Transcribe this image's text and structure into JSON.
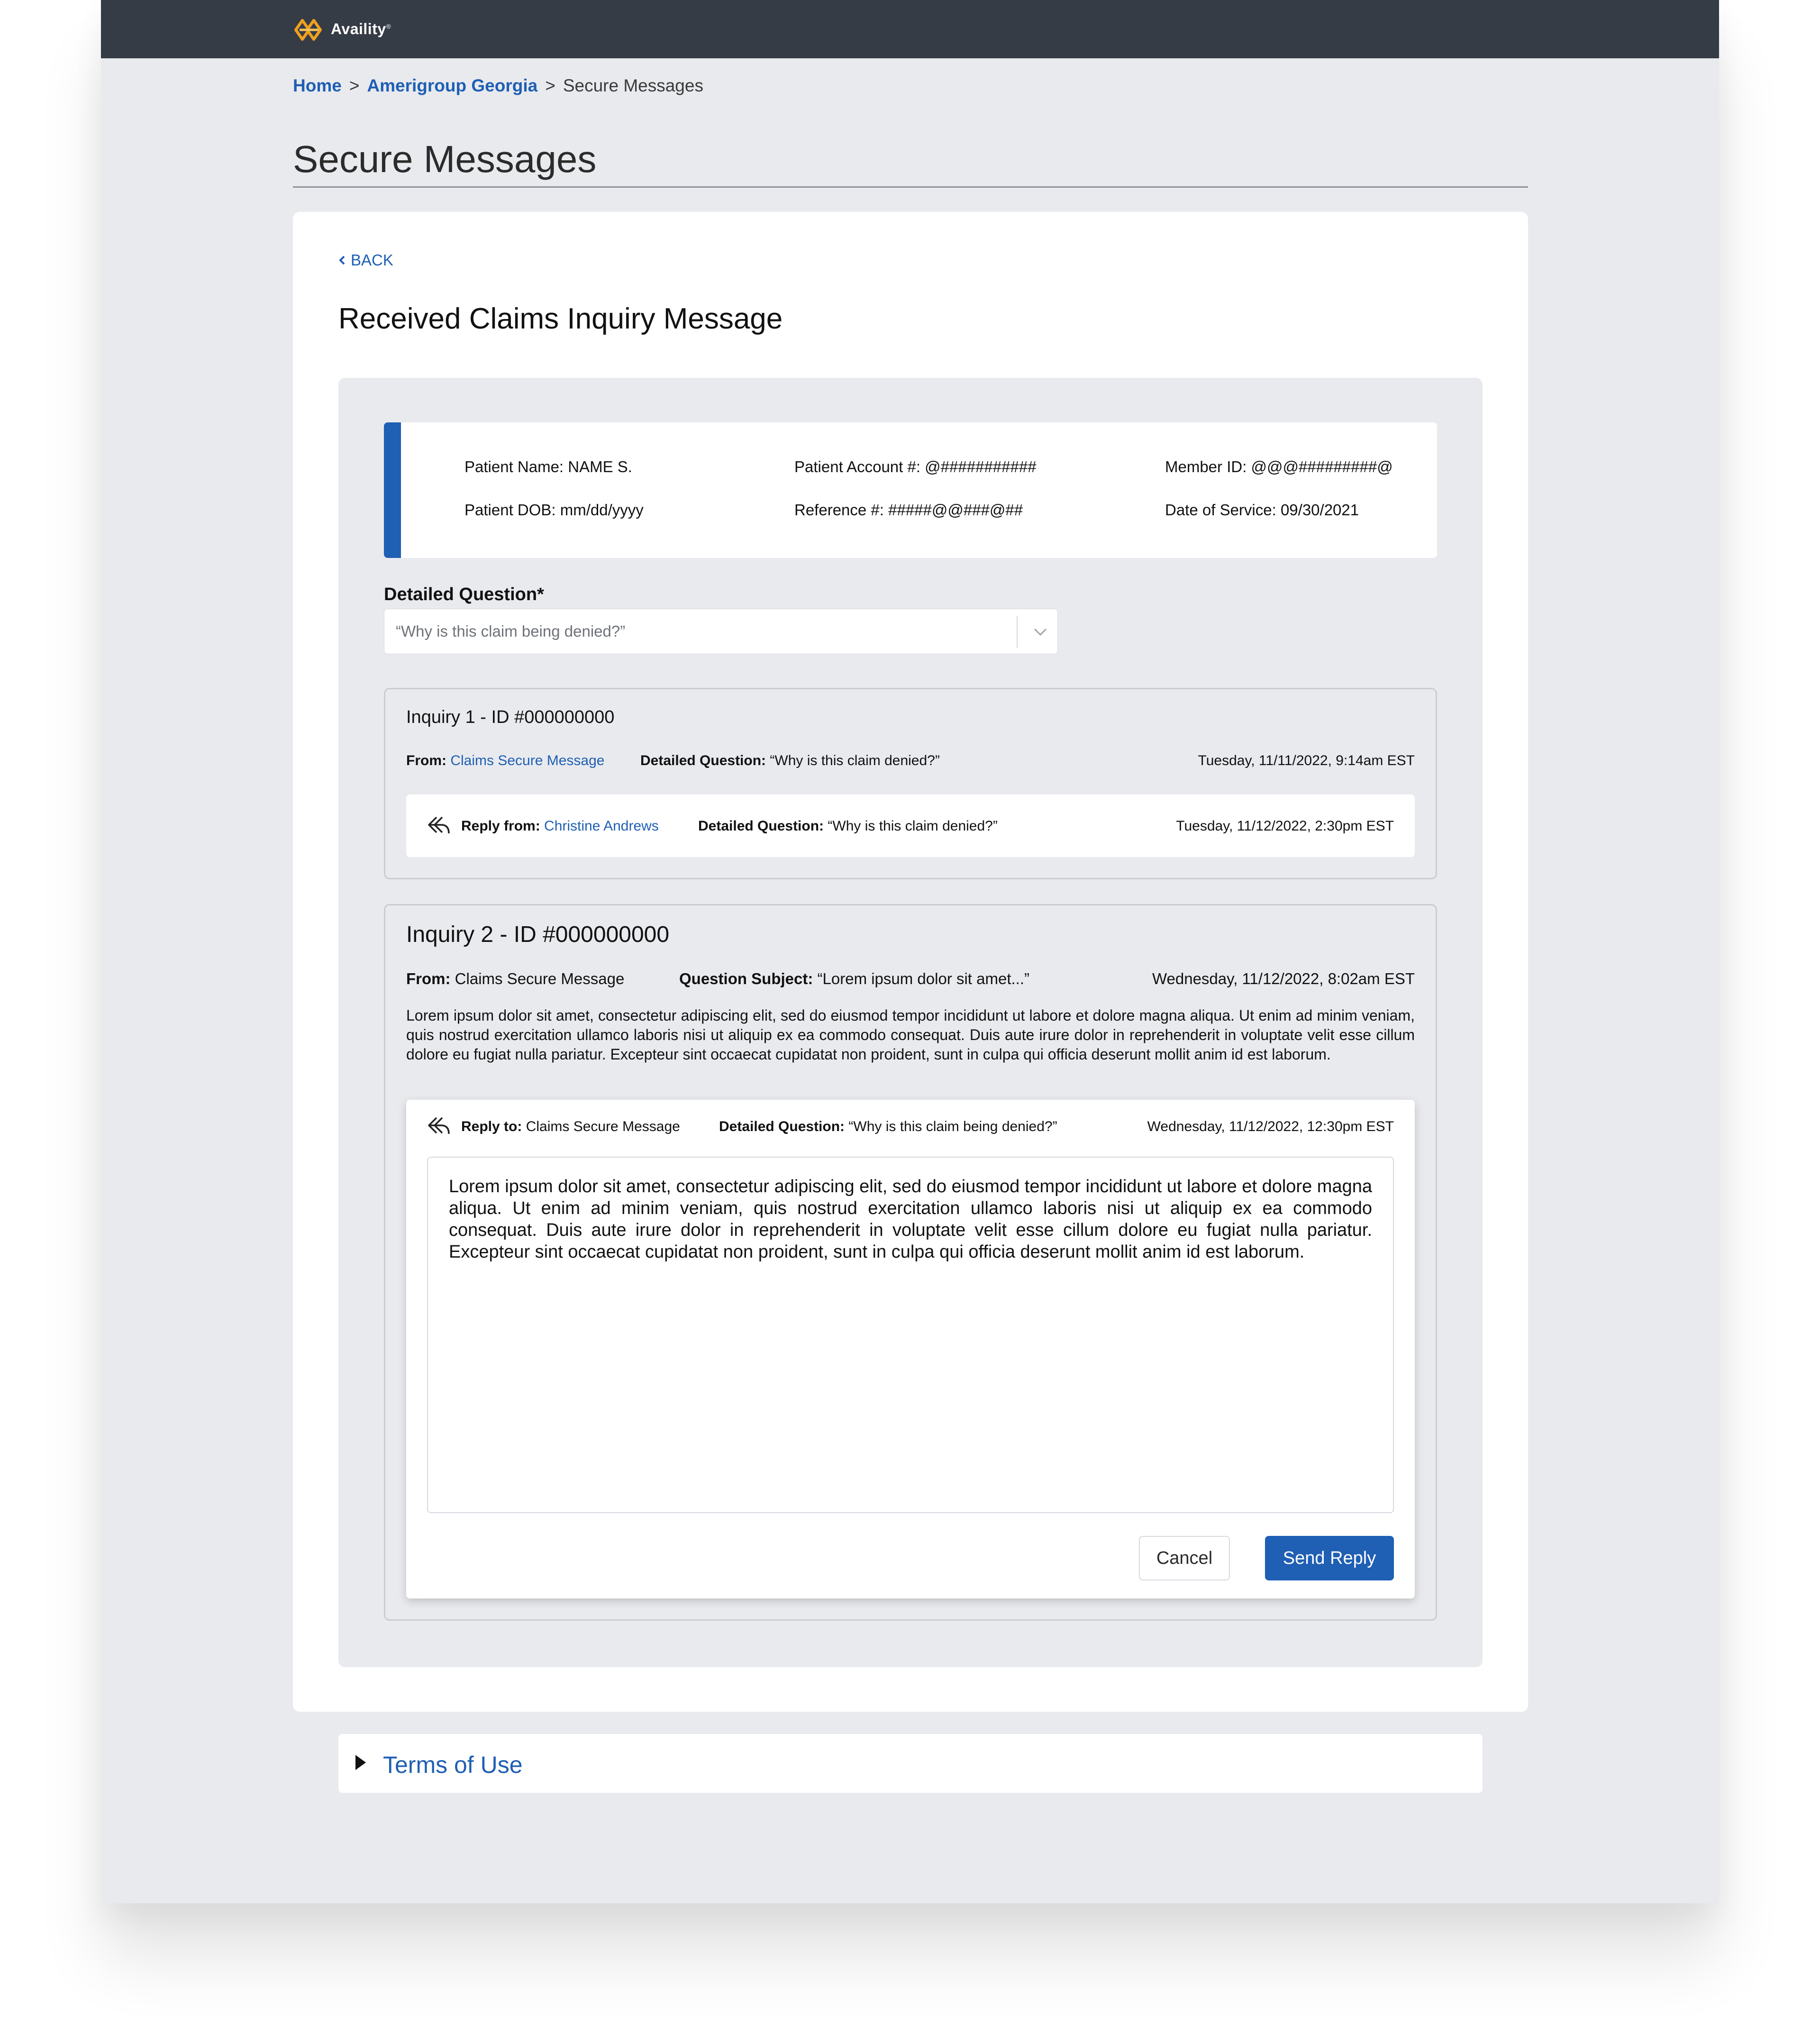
{
  "colors": {
    "accent": "#1f5fb4",
    "topbar": "#363c45",
    "page_bg": "#e9eaee",
    "logo": "#f0a020"
  },
  "header": {
    "logo_text": "Availity",
    "logo_tm": "®",
    "logo_icon": "availity-logo-icon"
  },
  "breadcrumb": {
    "items": [
      "Home",
      "Amerigroup Georgia",
      "Secure Messages"
    ],
    "separators": [
      ">",
      ">"
    ]
  },
  "page": {
    "title": "Secure Messages"
  },
  "card": {
    "back_label": "BACK",
    "heading": "Received Claims Inquiry Message"
  },
  "patient": {
    "name": "Patient Name: NAME S.",
    "account": "Patient Account #: @###########",
    "member_id": "Member ID: @@@#########@",
    "dob": "Patient DOB: mm/dd/yyyy",
    "reference": "Reference #: #####@@###@##",
    "dos": "Date of Service: 09/30/2021"
  },
  "detailed_question": {
    "label": "Detailed Question*",
    "value": "“Why is this claim being denied?”"
  },
  "inquiry1": {
    "title": "Inquiry 1 - ID #000000000",
    "from_label": "From:",
    "from_value": "Claims Secure Message",
    "dq_label": "Detailed Question:",
    "dq_value": "“Why is this claim denied?”",
    "date": "Tuesday, 11/11/2022, 9:14am EST",
    "reply": {
      "from_label": "Reply from:",
      "from_value": "Christine Andrews",
      "dq_label": "Detailed Question:",
      "dq_value": "“Why is this claim denied?”",
      "date": "Tuesday, 11/12/2022, 2:30pm EST"
    }
  },
  "inquiry2": {
    "title": "Inquiry 2 - ID #000000000",
    "from_label": "From:",
    "from_value": "Claims Secure Message",
    "subject_label": "Question Subject:",
    "subject_value": "“Lorem ipsum dolor sit amet...”",
    "date": "Wednesday, 11/12/2022, 8:02am EST",
    "body": "Lorem ipsum dolor sit amet, consectetur adipiscing elit, sed do eiusmod tempor incididunt ut labore et dolore magna aliqua. Ut enim ad minim veniam, quis nostrud exercitation ullamco laboris nisi ut aliquip ex ea commodo consequat. Duis aute irure dolor in reprehenderit in voluptate velit esse cillum dolore eu fugiat nulla pariatur. Excepteur sint occaecat cupidatat non proident, sunt in culpa qui officia deserunt mollit anim id est laborum.",
    "reply": {
      "to_label": "Reply to:",
      "to_value": "Claims Secure Message",
      "dq_label": "Detailed Question:",
      "dq_value": "“Why is this claim being denied?”",
      "date": "Wednesday, 11/12/2022, 12:30pm EST",
      "text": "Lorem ipsum dolor sit amet, consectetur adipiscing elit, sed do eiusmod tempor incididunt ut labore et dolore magna aliqua. Ut enim ad minim veniam, quis nostrud exercitation ullamco laboris nisi ut aliquip ex ea commodo consequat.  Duis aute irure dolor in reprehenderit in voluptate velit esse cillum dolore eu fugiat nulla pariatur. Excepteur sint occaecat cupidatat non proident, sunt in culpa qui officia deserunt mollit anim id est laborum.",
      "cancel_label": "Cancel",
      "send_label": "Send Reply"
    }
  },
  "footer": {
    "terms_label": "Terms of Use"
  }
}
